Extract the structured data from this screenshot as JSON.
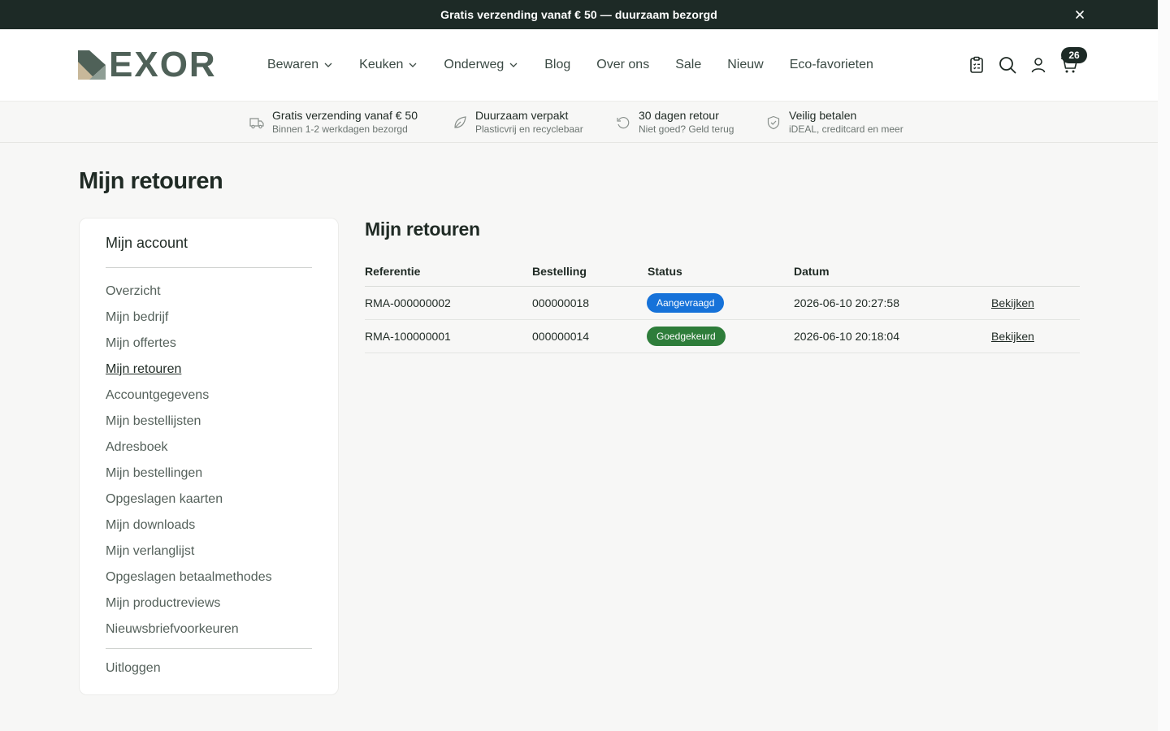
{
  "announcement": {
    "text": "Gratis verzending vanaf € 50 — duurzaam bezorgd",
    "close_icon": "close-icon"
  },
  "header": {
    "logo_text": "EXOR",
    "nav": [
      {
        "label": "Bewaren",
        "has_dropdown": true
      },
      {
        "label": "Keuken",
        "has_dropdown": true
      },
      {
        "label": "Onderweg",
        "has_dropdown": true
      },
      {
        "label": "Blog",
        "has_dropdown": false
      },
      {
        "label": "Over ons",
        "has_dropdown": false
      },
      {
        "label": "Sale",
        "has_dropdown": false
      },
      {
        "label": "Nieuw",
        "has_dropdown": false
      },
      {
        "label": "Eco-favorieten",
        "has_dropdown": false
      }
    ],
    "icons": [
      "clipboard-icon",
      "search-icon",
      "user-icon",
      "cart-icon"
    ],
    "cart_count": "26"
  },
  "usps": [
    {
      "icon": "truck-icon",
      "title": "Gratis verzending vanaf € 50",
      "subtitle": "Binnen 1-2 werkdagen bezorgd"
    },
    {
      "icon": "leaf-icon",
      "title": "Duurzaam verpakt",
      "subtitle": "Plasticvrij en recyclebaar"
    },
    {
      "icon": "return-icon",
      "title": "30 dagen retour",
      "subtitle": "Niet goed? Geld terug"
    },
    {
      "icon": "shield-icon",
      "title": "Veilig betalen",
      "subtitle": "iDEAL, creditcard en meer"
    }
  ],
  "page": {
    "title": "Mijn retouren"
  },
  "sidebar": {
    "title": "Mijn account",
    "items": [
      {
        "label": "Overzicht"
      },
      {
        "label": "Mijn bedrijf"
      },
      {
        "label": "Mijn offertes"
      },
      {
        "label": "Mijn retouren",
        "active": true
      },
      {
        "label": "Accountgegevens"
      },
      {
        "label": "Mijn bestellijsten"
      },
      {
        "label": "Adresboek"
      },
      {
        "label": "Mijn bestellingen"
      },
      {
        "label": "Opgeslagen kaarten"
      },
      {
        "label": "Mijn downloads"
      },
      {
        "label": "Mijn verlanglijst"
      },
      {
        "label": "Opgeslagen betaalmethodes"
      },
      {
        "label": "Mijn productreviews"
      },
      {
        "label": "Nieuwsbriefvoorkeuren"
      }
    ],
    "logout": "Uitloggen"
  },
  "main": {
    "title": "Mijn retouren",
    "columns": {
      "reference": "Referentie",
      "order": "Bestelling",
      "status": "Status",
      "date": "Datum"
    },
    "rows": [
      {
        "reference": "RMA-000000002",
        "order": "000000018",
        "status": "Aangevraagd",
        "status_color": "#1672d9",
        "date": "2026-06-10 20:27:58",
        "action": "Bekijken"
      },
      {
        "reference": "RMA-100000001",
        "order": "000000014",
        "status": "Goedgekeurd",
        "status_color": "#2e7d3a",
        "date": "2026-06-10 20:18:04",
        "action": "Bekijken"
      }
    ]
  },
  "colors": {
    "dark": "#1d2a26",
    "brand": "#4f6158",
    "accent_tan": "#c8b89a"
  }
}
